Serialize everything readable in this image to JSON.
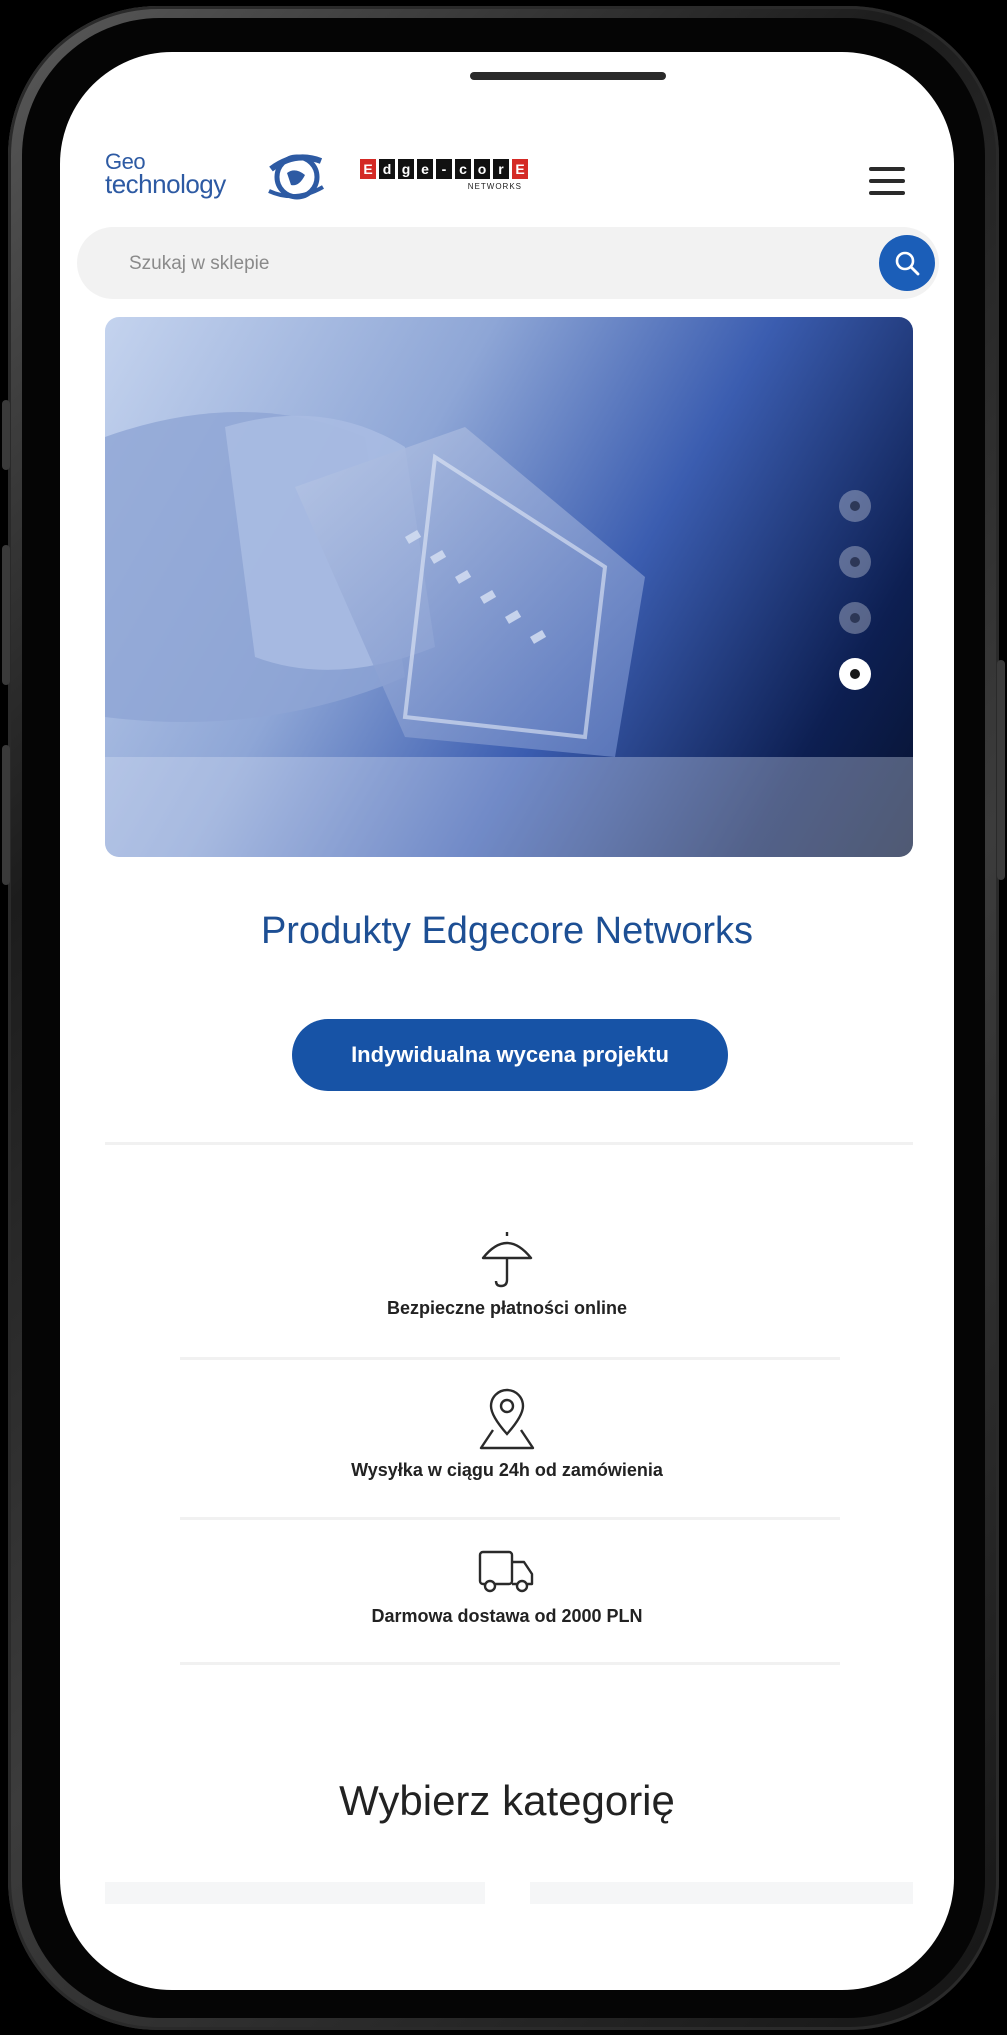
{
  "header": {
    "logo_geo_line1": "Geo",
    "logo_geo_line2": "technology",
    "logo_edgecore_letters": [
      "E",
      "d",
      "g",
      "e",
      "-",
      "c",
      "o",
      "r",
      "E"
    ],
    "logo_edgecore_sub": "NETWORKS"
  },
  "search": {
    "placeholder": "Szukaj w sklepie"
  },
  "hero": {
    "slide_count": 4,
    "active_slide": 4
  },
  "main": {
    "title": "Produkty Edgecore Networks",
    "cta_label": "Indywidualna wycena projektu"
  },
  "features": [
    {
      "icon": "umbrella-icon",
      "label": "Bezpieczne płatności online"
    },
    {
      "icon": "map-pin-icon",
      "label": "Wysyłka w ciągu 24h od zamówienia"
    },
    {
      "icon": "truck-icon",
      "label": "Darmowa dostawa od 2000 PLN"
    }
  ],
  "category": {
    "title": "Wybierz kategorię"
  },
  "colors": {
    "primary": "#1753a6",
    "title": "#1d4f94"
  }
}
